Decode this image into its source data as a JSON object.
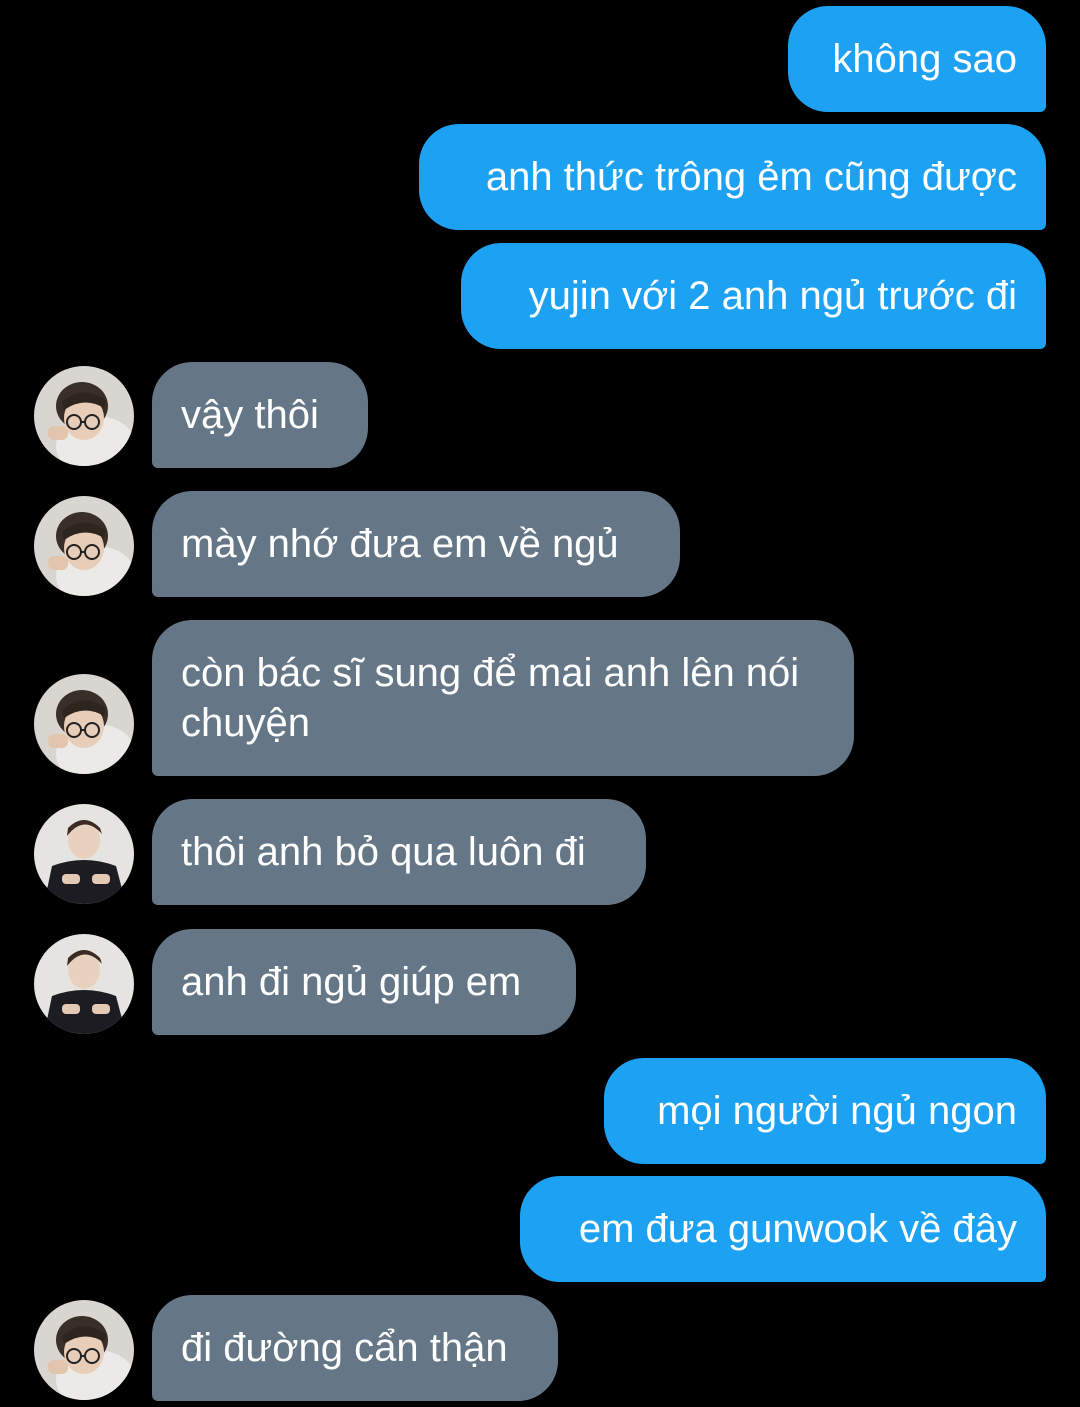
{
  "colors": {
    "background": "#000000",
    "sent_bubble": "#1da1f2",
    "received_bubble": "#657786",
    "text": "#ffffff"
  },
  "messages": [
    {
      "side": "sent",
      "text": "không sao"
    },
    {
      "side": "sent",
      "text": "anh thức trông ẻm cũng được"
    },
    {
      "side": "sent",
      "text": "yujin với 2 anh ngủ trước đi"
    },
    {
      "side": "received",
      "avatar": "avatar-glasses-boy",
      "text": "vậy thôi"
    },
    {
      "side": "received",
      "avatar": "avatar-glasses-boy",
      "text": "mày nhớ đưa em về ngủ"
    },
    {
      "side": "received",
      "avatar": "avatar-glasses-boy",
      "text": "còn bác sĩ sung để mai anh lên nói chuyện"
    },
    {
      "side": "received",
      "avatar": "avatar-dark-jacket-boy",
      "text": "thôi anh bỏ qua luôn đi"
    },
    {
      "side": "received",
      "avatar": "avatar-dark-jacket-boy",
      "text": "anh đi ngủ giúp em"
    },
    {
      "side": "sent",
      "text": "mọi người ngủ ngon"
    },
    {
      "side": "sent",
      "text": "em đưa gunwook về đây"
    },
    {
      "side": "received",
      "avatar": "avatar-glasses-boy",
      "text": "đi đường cẩn thận"
    }
  ]
}
